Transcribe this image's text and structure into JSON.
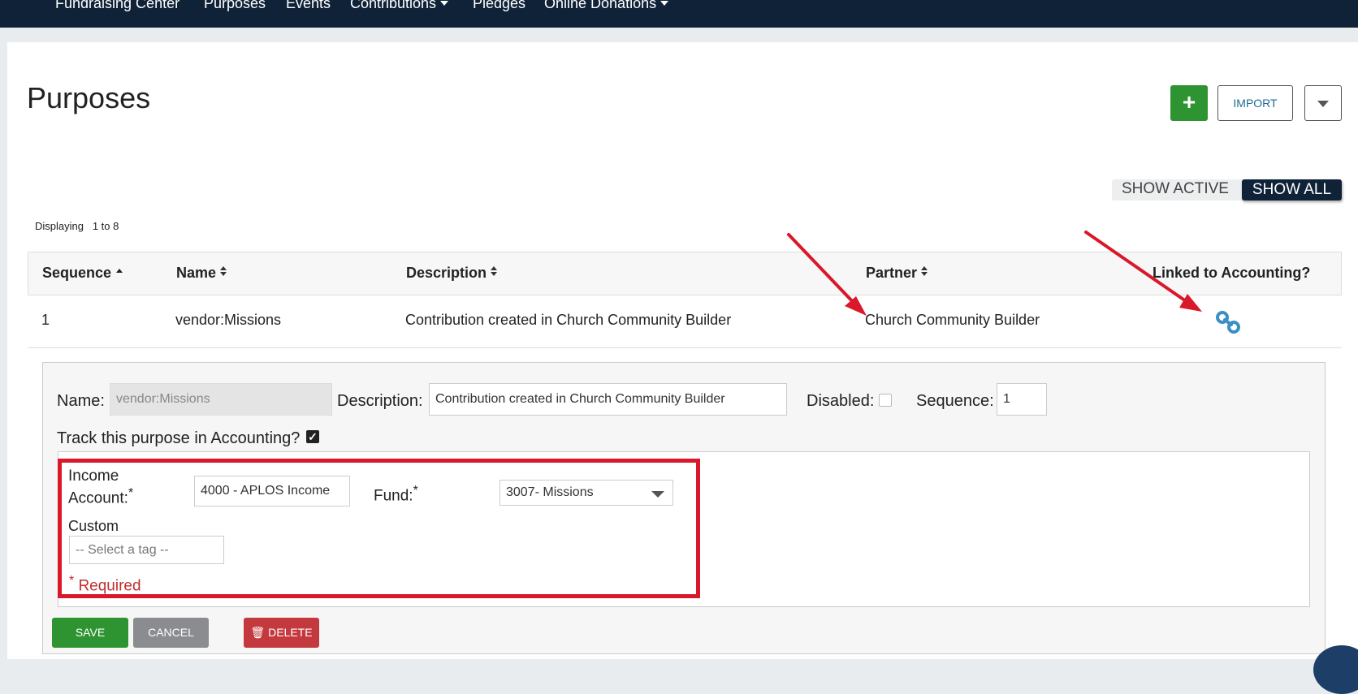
{
  "nav": {
    "items": [
      "Fundraising Center",
      "Purposes",
      "Events",
      "Contributions",
      "Pledges",
      "Online Donations"
    ]
  },
  "page": {
    "title": "Purposes",
    "add_icon": "plus-icon",
    "import_label": "IMPORT",
    "show_active_label": "SHOW ACTIVE",
    "show_all_label": "SHOW ALL",
    "displaying_label": "Displaying",
    "displaying_range": "1 to 8"
  },
  "table": {
    "columns": [
      "Sequence",
      "Name",
      "Description",
      "Partner",
      "Linked to Accounting?"
    ],
    "rows": [
      {
        "sequence": "1",
        "name": "vendor:Missions",
        "description": "Contribution created in Church Community Builder",
        "partner": "Church Community Builder",
        "linked_icon": "link-icon"
      }
    ]
  },
  "edit": {
    "name_label": "Name:",
    "name_value": "vendor:Missions",
    "description_label": "Description:",
    "description_value": "Contribution created in Church Community Builder",
    "disabled_label": "Disabled:",
    "sequence_label": "Sequence:",
    "sequence_value": "1",
    "track_label": "Track this purpose in Accounting?",
    "track_checked": "✓",
    "income_account_label_1": "Income",
    "income_account_label_2": "Account:",
    "income_account_value": "4000 - APLOS Income",
    "fund_label": "Fund:",
    "fund_value": "3007- Missions",
    "custom_label": "Custom",
    "tag_placeholder": "-- Select a tag --",
    "asterisk": "*",
    "required_label": "Required",
    "save_label": "SAVE",
    "cancel_label": "CANCEL",
    "delete_label": "DELETE"
  },
  "colors": {
    "nav_bg": "#0f2238",
    "green": "#2e9431",
    "annotation_red": "#d9182a",
    "link_blue": "#3a8fc4"
  }
}
